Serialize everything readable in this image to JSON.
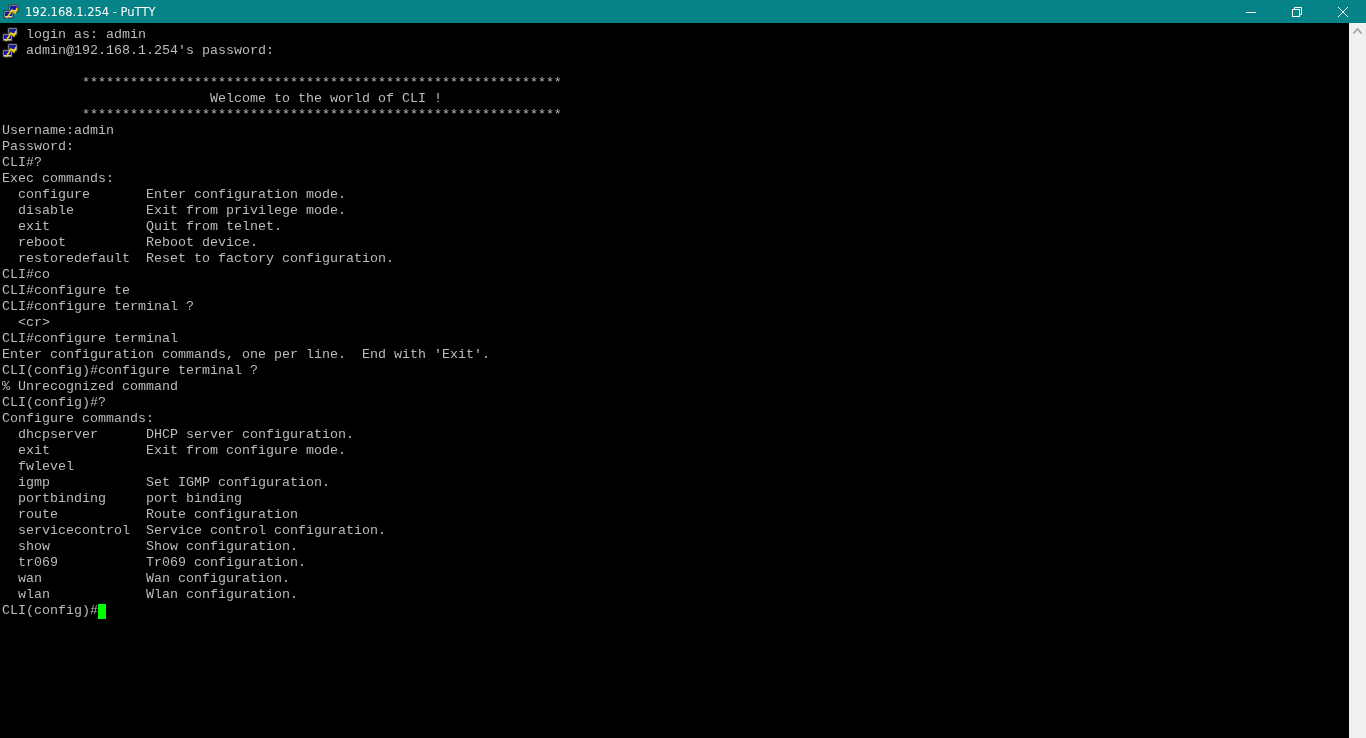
{
  "window": {
    "title": "192.168.1.254 - PuTTY"
  },
  "terminal": {
    "lines": [
      {
        "kind": "log",
        "text": "login as: admin"
      },
      {
        "kind": "log",
        "text": "admin@192.168.1.254's password:"
      },
      {
        "kind": "blank"
      },
      {
        "kind": "text",
        "text": "          ************************************************************"
      },
      {
        "kind": "text",
        "text": "                          Welcome to the world of CLI !"
      },
      {
        "kind": "text",
        "text": "          ************************************************************"
      },
      {
        "kind": "text",
        "text": "Username:admin"
      },
      {
        "kind": "text",
        "text": "Password:"
      },
      {
        "kind": "text",
        "text": "CLI#?"
      },
      {
        "kind": "text",
        "text": "Exec commands:"
      },
      {
        "kind": "command",
        "name": "configure",
        "description": "Enter configuration mode."
      },
      {
        "kind": "command",
        "name": "disable",
        "description": "Exit from privilege mode."
      },
      {
        "kind": "command",
        "name": "exit",
        "description": "Quit from telnet."
      },
      {
        "kind": "command",
        "name": "reboot",
        "description": "Reboot device."
      },
      {
        "kind": "command",
        "name": "restoredefault",
        "description": "Reset to factory configuration."
      },
      {
        "kind": "text",
        "text": "CLI#co"
      },
      {
        "kind": "text",
        "text": "CLI#configure te"
      },
      {
        "kind": "text",
        "text": "CLI#configure terminal ?"
      },
      {
        "kind": "command",
        "name": "<cr>"
      },
      {
        "kind": "text",
        "text": "CLI#configure terminal"
      },
      {
        "kind": "text",
        "text": "Enter configuration commands, one per line.  End with 'Exit'."
      },
      {
        "kind": "text",
        "text": "CLI(config)#configure terminal ?"
      },
      {
        "kind": "text",
        "text": "% Unrecognized command"
      },
      {
        "kind": "text",
        "text": "CLI(config)#?"
      },
      {
        "kind": "text",
        "text": "Configure commands:"
      },
      {
        "kind": "command",
        "name": "dhcpserver",
        "description": "DHCP server configuration."
      },
      {
        "kind": "command",
        "name": "exit",
        "description": "Exit from configure mode."
      },
      {
        "kind": "command",
        "name": "fwlevel"
      },
      {
        "kind": "command",
        "name": "igmp",
        "description": "Set IGMP configuration."
      },
      {
        "kind": "command",
        "name": "portbinding",
        "description": "port binding"
      },
      {
        "kind": "command",
        "name": "route",
        "description": "Route configuration"
      },
      {
        "kind": "command",
        "name": "servicecontrol",
        "description": "Service control configuration."
      },
      {
        "kind": "command",
        "name": "show",
        "description": "Show configuration."
      },
      {
        "kind": "command",
        "name": "tr069",
        "description": "Tr069 configuration."
      },
      {
        "kind": "command",
        "name": "wan",
        "description": "Wan configuration."
      },
      {
        "kind": "command",
        "name": "wlan",
        "description": "Wlan configuration."
      },
      {
        "kind": "prompt",
        "text": "CLI(config)#"
      }
    ]
  }
}
